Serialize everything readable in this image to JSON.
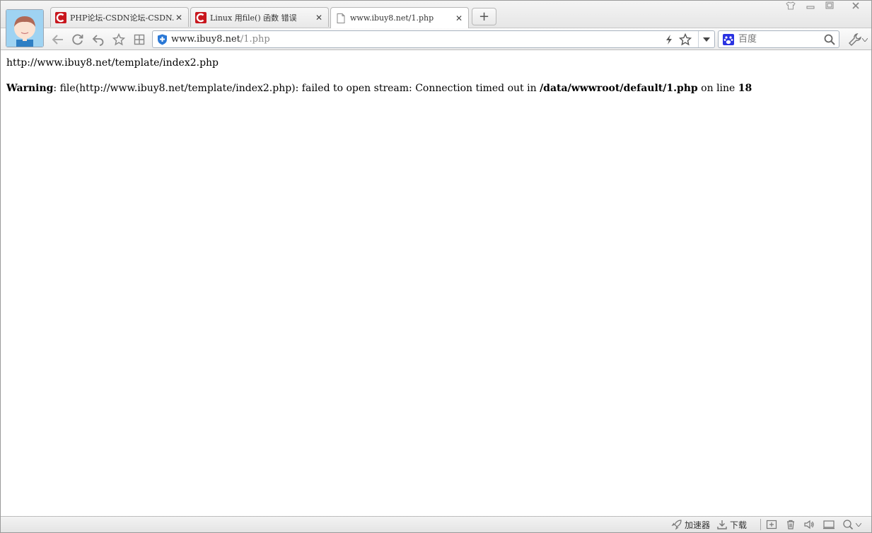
{
  "tabs": [
    {
      "title": "PHP论坛-CSDN论坛-CSDN.NET",
      "favicon": "csdn-icon",
      "active": false
    },
    {
      "title": "Linux 用file() 函数 错误",
      "favicon": "csdn-icon",
      "active": false
    },
    {
      "title": "www.ibuy8.net/1.php",
      "favicon": "page-icon",
      "active": true
    }
  ],
  "new_tab_label": "+",
  "address": {
    "domain": "www.ibuy8.net",
    "path": "/1.php"
  },
  "search": {
    "placeholder": "百度",
    "engine_icon": "baidu-icon"
  },
  "page": {
    "line1": "http://www.ibuy8.net/template/index2.php",
    "warning_label": "Warning",
    "warning_text_1": ": file(http://www.ibuy8.net/template/index2.php): failed to open stream: Connection timed out in ",
    "warning_file": "/data/wwwroot/default/1.php",
    "warning_text_2": " on line ",
    "warning_line": "18"
  },
  "statusbar": {
    "accelerator": "加速器",
    "download": "下载"
  },
  "colors": {
    "csdn_red": "#c8161d",
    "shield_blue": "#2a78d6",
    "baidu_blue": "#2932e1"
  }
}
